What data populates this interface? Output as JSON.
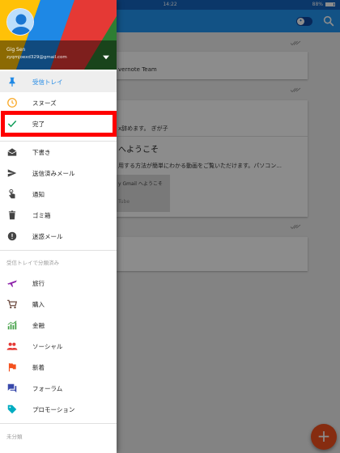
{
  "status_bar": {
    "time": "14:22",
    "battery": "88%"
  },
  "account": {
    "name": "Gig Sen",
    "email": "zyqmjoexd329@gmail.com"
  },
  "nav": {
    "primary": [
      {
        "label": "受信トレイ",
        "icon": "pin-icon",
        "selected": true
      },
      {
        "label": "スヌーズ",
        "icon": "clock-icon"
      },
      {
        "label": "完了",
        "icon": "check-icon",
        "highlighted": true
      }
    ],
    "secondary": [
      {
        "label": "下書き",
        "icon": "drafts-icon"
      },
      {
        "label": "送信済みメール",
        "icon": "send-icon"
      },
      {
        "label": "通知",
        "icon": "touch-icon"
      },
      {
        "label": "ゴミ箱",
        "icon": "trash-icon"
      },
      {
        "label": "迷惑メール",
        "icon": "spam-icon"
      }
    ],
    "bundles_header": "受信トレイで分類済み",
    "bundles": [
      {
        "label": "旅行",
        "icon": "plane-icon",
        "color": "#8e24aa"
      },
      {
        "label": "購入",
        "icon": "cart-icon",
        "color": "#6d4c41"
      },
      {
        "label": "金融",
        "icon": "chart-icon",
        "color": "#43a047"
      },
      {
        "label": "ソーシャル",
        "icon": "people-icon",
        "color": "#e53935"
      },
      {
        "label": "新着",
        "icon": "flag-icon",
        "color": "#f4511e"
      },
      {
        "label": "フォーラム",
        "icon": "forum-icon",
        "color": "#3949ab"
      },
      {
        "label": "プロモーション",
        "icon": "tag-icon",
        "color": "#00acc1"
      }
    ],
    "unbundled_label": "未分類"
  },
  "content": {
    "card1_text": "vernote Team",
    "card2_line1": "x辞めます。 ぎが子",
    "card2_line2": "へようこそ",
    "card2_line3": "用する方法が簡単にわかる動画をご覧いただけます。パソコン...",
    "thumb_line1": "y Gmail へようこそ",
    "thumb_line2": "Tube"
  },
  "colors": {
    "accent": "#2196f3",
    "highlight": "#ff0000",
    "fab": "#f4511e"
  }
}
